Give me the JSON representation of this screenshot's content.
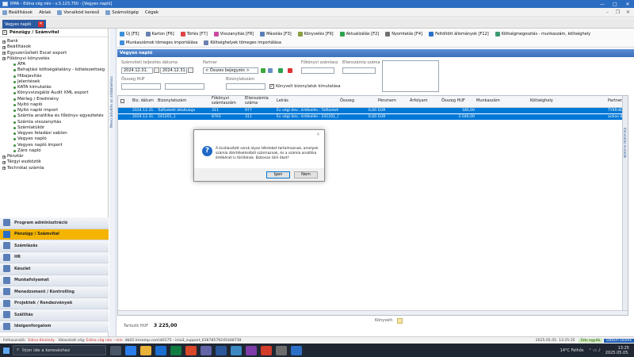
{
  "titlebar": {
    "title": "RMA - Edina cég név - v.3.123.750 - [Vegyes napló]"
  },
  "menubar": {
    "items": [
      "Beállítások",
      "Ablak",
      "Vonalkód kereső",
      "Számológép",
      "Cégek"
    ]
  },
  "tabs": {
    "active": "Vegyes napló"
  },
  "left_panel": {
    "header": "Pénzügy / Számvitel",
    "tree": [
      {
        "label": "Bank",
        "level": 1
      },
      {
        "label": "Beállítások",
        "level": 1
      },
      {
        "label": "Egyszerűsített Excel export",
        "level": 1
      },
      {
        "label": "Főkönyvi könyvelés",
        "level": 1
      },
      {
        "label": "ÁFA",
        "level": 2
      },
      {
        "label": "Behajtási költségátalány - kötelezettség",
        "level": 2
      },
      {
        "label": "Hibajavítás",
        "level": 2
      },
      {
        "label": "Jelentések",
        "level": 2
      },
      {
        "label": "KATA kimutatás",
        "level": 2
      },
      {
        "label": "Könyvvizsgálói Audit XML export",
        "level": 2
      },
      {
        "label": "Mérleg / Eredmény",
        "level": 2
      },
      {
        "label": "Nyitó napló",
        "level": 2
      },
      {
        "label": "Nyitó napló import",
        "level": 2
      },
      {
        "label": "Számla analitika és főkönyv egyeztetés",
        "level": 2
      },
      {
        "label": "Számla visszanyitás",
        "level": 2
      },
      {
        "label": "Számlatükör",
        "level": 2
      },
      {
        "label": "Vegyes feladási sablon",
        "level": 2
      },
      {
        "label": "Vegyes napló",
        "level": 2
      },
      {
        "label": "Vegyes napló import",
        "level": 2
      },
      {
        "label": "Záró napló",
        "level": 2
      },
      {
        "label": "Pénztár",
        "level": 1
      },
      {
        "label": "Tárgyi eszközök",
        "level": 1
      },
      {
        "label": "Technikai számla",
        "level": 1
      }
    ],
    "modules": [
      "Program adminisztráció",
      "Pénzügy / Számvitel",
      "Számlázás",
      "HR",
      "Készlet",
      "Munkafolyamat",
      "Menedzsment / Kontrolling",
      "Projektek / Rendezvények",
      "Szállítás",
      "Ideigenforgalom"
    ],
    "active_module": "Pénzügy / Számvitel"
  },
  "vertical_strip": {
    "label": "Menü bővítés az alábbiakhoz"
  },
  "toolbar": {
    "row1": [
      "Új [F5]",
      "Karton [F6]",
      "Törlés [F7]",
      "Visszanyitás [F8]",
      "Másolás [F3]",
      "Könyvelés [F9]",
      "Aktualizálás [F2]",
      "Nyomtatás [F4]",
      "Feltöltött állományok [F12]",
      "Költségmegosztás - munkaszám, költséghely"
    ],
    "row2": [
      "Munkaszámok tömeges importálása",
      "Költséghelyek tömeges importálása"
    ]
  },
  "panel": {
    "title": "Vegyes napló"
  },
  "filters": {
    "date_label": "Számviteli teljesítés dátuma",
    "date_from": "2024.12.31.",
    "date_to": "2024.12.31.",
    "partner_label": "Partner",
    "partner_value": "< Összes bejegyzés >",
    "fokonyvi_label": "Főkönyvi számlasz",
    "ellenszamla_label": "Ellenszámla száma",
    "osszeg_label": "Összeg HUF",
    "bizonylat_label": "Bizonylatszám",
    "checkbox_label": "Könyvelt bizonylatok kimutatása"
  },
  "grid": {
    "columns": [
      "Biz. dátum",
      "Bizonylatszám",
      "Főkönyvi számlaszám",
      "Ellenszámla száma",
      "Leírás",
      "Összeg",
      "Pénznem",
      "Árfolyam",
      "Összeg HUF",
      "Munkaszám",
      "Költséghely",
      "Partner"
    ],
    "rows": [
      {
        "date": "2024.12.31.",
        "doc": "Túlfizetett általtulaja",
        "fok": "311",
        "ellen": "977",
        "desc": "Év végi dev.. értékelés - Túlfizetett ált",
        "amount": "0,00",
        "cur": "EUR",
        "rate": "",
        "huf": "185,00",
        "ws": "",
        "cc": "",
        "partner": "TYKR-KOL"
      },
      {
        "date": "2024.12.31.",
        "doc": "241201_1",
        "fok": "8763",
        "ellen": "311",
        "desc": "Év végi dev.. értékelés - 241201_1",
        "amount": "0,00",
        "cur": "EUR",
        "rate": "",
        "huf": "3 040,00",
        "ws": "",
        "cc": "",
        "partner": "action B0"
      }
    ],
    "side_label": "Kimutatás mutatók"
  },
  "footer": {
    "tartozik_label": "Tartozik HUF",
    "tartozik_value": "3 225,00",
    "konyvelt_label": "Könyvelt:"
  },
  "dialog": {
    "message": "A kiválasztott sorok olyan tételeket tartalmaznak, amelyek számla átértékeléséből származnak, és a számla analitika értékénél is törlődnek. Biztosan törli őket?",
    "yes": "Igen",
    "no": "Nem",
    "close": "×"
  },
  "statusbar": {
    "felhasznalo_label": "Felhasználó:",
    "user": "Edina Kiceindy",
    "ceg_label": "Választott cég:",
    "company": "Edina cég név - min",
    "db": "db02.imsemp.com\\40175 - ima3_support_63678579245448739",
    "datetime": "2025.05.05. 13:25:35",
    "badge1": "Üdv egyéb",
    "badge2": "Dátum szűrés"
  },
  "taskbar": {
    "search_placeholder": "Írjon ide a kereséshez",
    "weather": "14°C  Felhős",
    "time": "13:25",
    "date": "2025.05.05."
  }
}
